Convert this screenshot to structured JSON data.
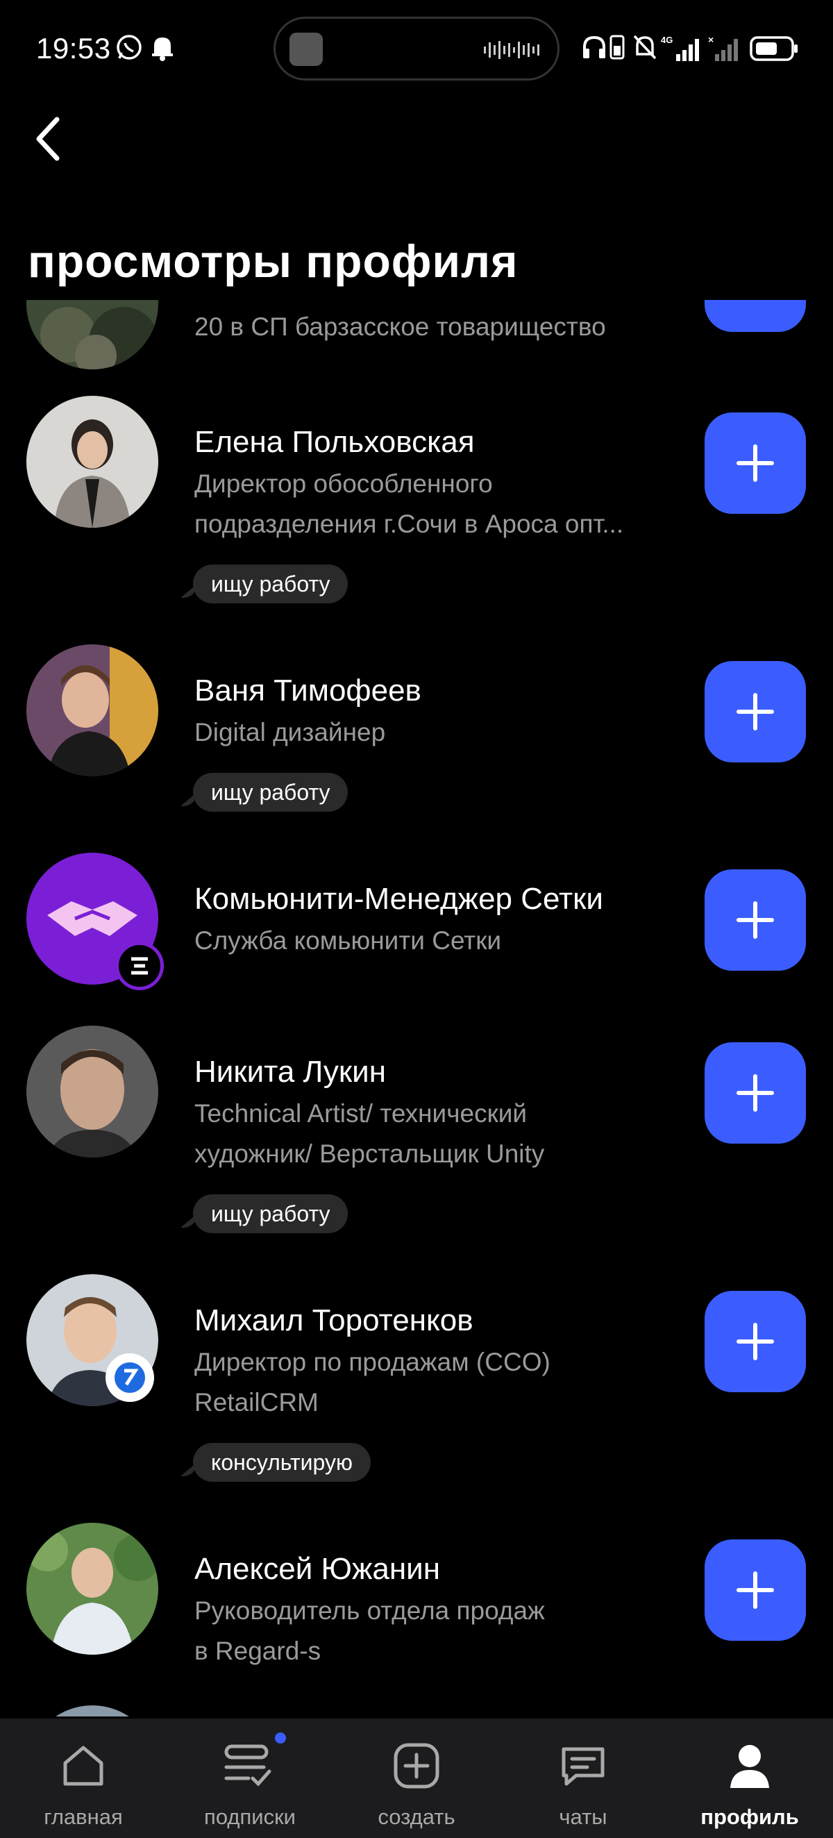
{
  "status_bar": {
    "time": "19:53",
    "network": "4G"
  },
  "header": {
    "title": "просмотры профиля"
  },
  "profiles": [
    {
      "name": "",
      "subtitle": [
        "20 в СП барзасское товарищество"
      ],
      "tag": ""
    },
    {
      "name": "Елена Польховская",
      "subtitle": [
        "Директор обособленного",
        "подразделения г.Сочи в Ароса опт..."
      ],
      "tag": "ищу работу"
    },
    {
      "name": "Ваня Тимофеев",
      "subtitle": [
        "Digital дизайнер"
      ],
      "tag": "ищу работу"
    },
    {
      "name": "Комьюнити-Менеджер Сетки",
      "subtitle": [
        "Служба комьюнити Сетки"
      ],
      "tag": ""
    },
    {
      "name": "Никита Лукин",
      "subtitle": [
        "Technical Artist/ технический",
        "художник/ Верстальщик Unity"
      ],
      "tag": "ищу работу"
    },
    {
      "name": "Михаил Торотенков",
      "subtitle": [
        "Директор по продажам (CCO)",
        "RetailCRM"
      ],
      "tag": "консультирую"
    },
    {
      "name": "Алексей Южанин",
      "subtitle": [
        "Руководитель отдела продаж",
        "в Regard-s"
      ],
      "tag": ""
    }
  ],
  "nav": {
    "items": [
      {
        "label": "главная",
        "icon": "home-icon"
      },
      {
        "label": "подписки",
        "icon": "subscriptions-icon"
      },
      {
        "label": "создать",
        "icon": "create-icon"
      },
      {
        "label": "чаты",
        "icon": "chat-icon"
      },
      {
        "label": "профиль",
        "icon": "profile-icon"
      }
    ],
    "active": "профиль"
  },
  "colors": {
    "accent": "#3b5dff",
    "background": "#000000",
    "nav_bg": "#1c1c1e",
    "muted_text": "#9a9a9a"
  }
}
